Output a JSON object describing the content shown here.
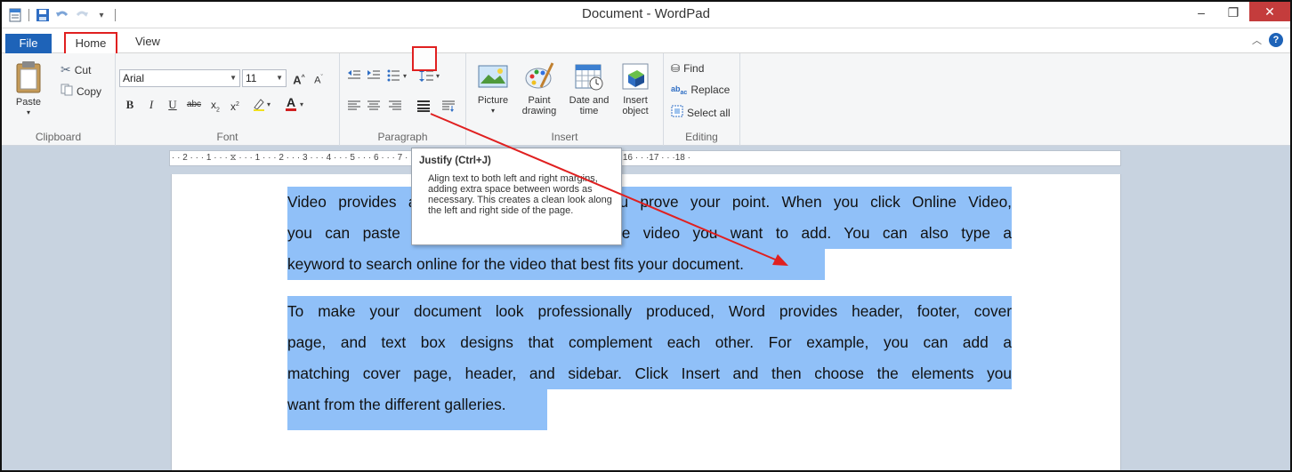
{
  "window": {
    "title": "Document - WordPad",
    "minimize_glyph": "–",
    "restore_glyph": "❐",
    "close_glyph": "✕"
  },
  "tabs": {
    "file": "File",
    "home": "Home",
    "view": "View"
  },
  "ribbon": {
    "clipboard": {
      "label": "Clipboard",
      "paste": "Paste",
      "cut": "Cut",
      "copy": "Copy"
    },
    "font": {
      "label": "Font",
      "family": "Arial",
      "size": "11"
    },
    "paragraph": {
      "label": "Paragraph"
    },
    "insert": {
      "label": "Insert",
      "picture": "Picture",
      "paint_line1": "Paint",
      "paint_line2": "drawing",
      "datetime_line1": "Date and",
      "datetime_line2": "time",
      "object_line1": "Insert",
      "object_line2": "object"
    },
    "editing": {
      "label": "Editing",
      "find": "Find",
      "replace": "Replace",
      "select_all": "Select all"
    }
  },
  "ruler": {
    "text": "· · 2 · · · 1 · · · ⧖ · · · 1 · · · 2 · · · 3 · · · 4 · · · 5 · · · 6 · · · 7 · · · 8 · · · 9 · · ·10 · · ·11 · · ·12 · · ·13 · · ·14 · · ·15 · · ·16 · · ·17 · · ·18 ·"
  },
  "tooltip": {
    "title": "Justify (Ctrl+J)",
    "body": "Align text to both left and right margins, adding extra space between words as necessary. This creates a clean look along the left and right side of the page."
  },
  "document": {
    "p1_l1": "Video provides a powerful way to help you prove your point. When you click Online Video,",
    "p1_l2": "you can paste in the embed code for the video you want to add. You can also type a",
    "p1_l3": "keyword to search online for the video that best fits your document.",
    "p2_l1": "To make your document look professionally produced, Word provides header, footer, cover",
    "p2_l2": "page, and text box designs that complement each other. For example, you can add a",
    "p2_l3": "matching cover page, header, and sidebar. Click Insert and then choose the elements you",
    "p2_l4": "want from the different galleries."
  },
  "colors": {
    "accent": "#1e63b8",
    "highlight": "#90c0f8",
    "callout": "#e02020",
    "close": "#c43c3c"
  }
}
